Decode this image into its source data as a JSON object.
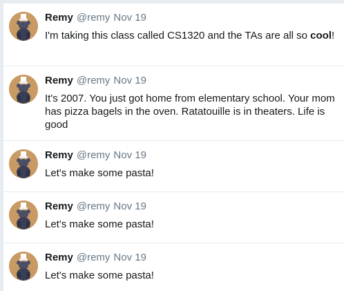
{
  "tweets": [
    {
      "name": "Remy",
      "handle": "@remy",
      "date": "Nov 19",
      "text_parts": [
        "I'm taking this class called CS1320 and the TAs are all so ",
        "cool",
        "!"
      ]
    },
    {
      "name": "Remy",
      "handle": "@remy",
      "date": "Nov 19",
      "text": "It's 2007. You just got home from elementary school. Your mom has pizza bagels in the oven. Ratatouille is in theaters. Life is good"
    },
    {
      "name": "Remy",
      "handle": "@remy",
      "date": "Nov 19",
      "text": "Let's make some pasta!"
    },
    {
      "name": "Remy",
      "handle": "@remy",
      "date": "Nov 19",
      "text": "Let's make some pasta!"
    },
    {
      "name": "Remy",
      "handle": "@remy",
      "date": "Nov 19",
      "text": "Let's make some pasta!"
    }
  ],
  "avatar": {
    "icon": "rat-chef-avatar-icon",
    "bg_color": "#c99a63",
    "figure_color": "#3b3f55"
  },
  "colors": {
    "name": "#14171a",
    "secondary": "#657786",
    "divider": "#e6ecf0"
  }
}
